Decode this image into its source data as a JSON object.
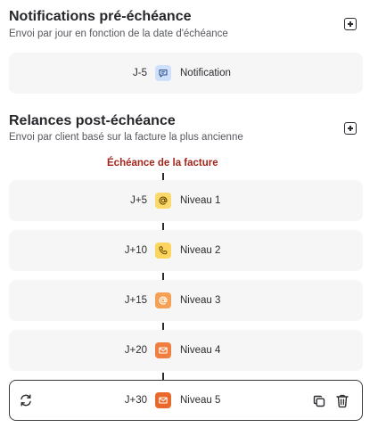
{
  "pre_due": {
    "title": "Notifications pré-échéance",
    "subtitle": "Envoi par jour en fonction de la date d'échéance",
    "items": [
      {
        "delay": "J-5",
        "label": "Notification",
        "icon": "message-icon",
        "color": "#cfe0fb"
      }
    ]
  },
  "post_due": {
    "title": "Relances post-échéance",
    "subtitle": "Envoi par client basé sur la facture la plus ancienne",
    "due_marker": "Échéance de la facture",
    "levels": [
      {
        "delay": "J+5",
        "label": "Niveau 1",
        "icon": "at-icon",
        "color": "#fbd96a"
      },
      {
        "delay": "J+10",
        "label": "Niveau 2",
        "icon": "phone-icon",
        "color": "#fbd55e"
      },
      {
        "delay": "J+15",
        "label": "Niveau 3",
        "icon": "at-icon",
        "color": "#f5a055"
      },
      {
        "delay": "J+20",
        "label": "Niveau 4",
        "icon": "mail-icon",
        "color": "#f07f3f"
      },
      {
        "delay": "J+30",
        "label": "Niveau 5",
        "icon": "mail-icon",
        "color": "#e8692b",
        "selected": true
      }
    ]
  }
}
